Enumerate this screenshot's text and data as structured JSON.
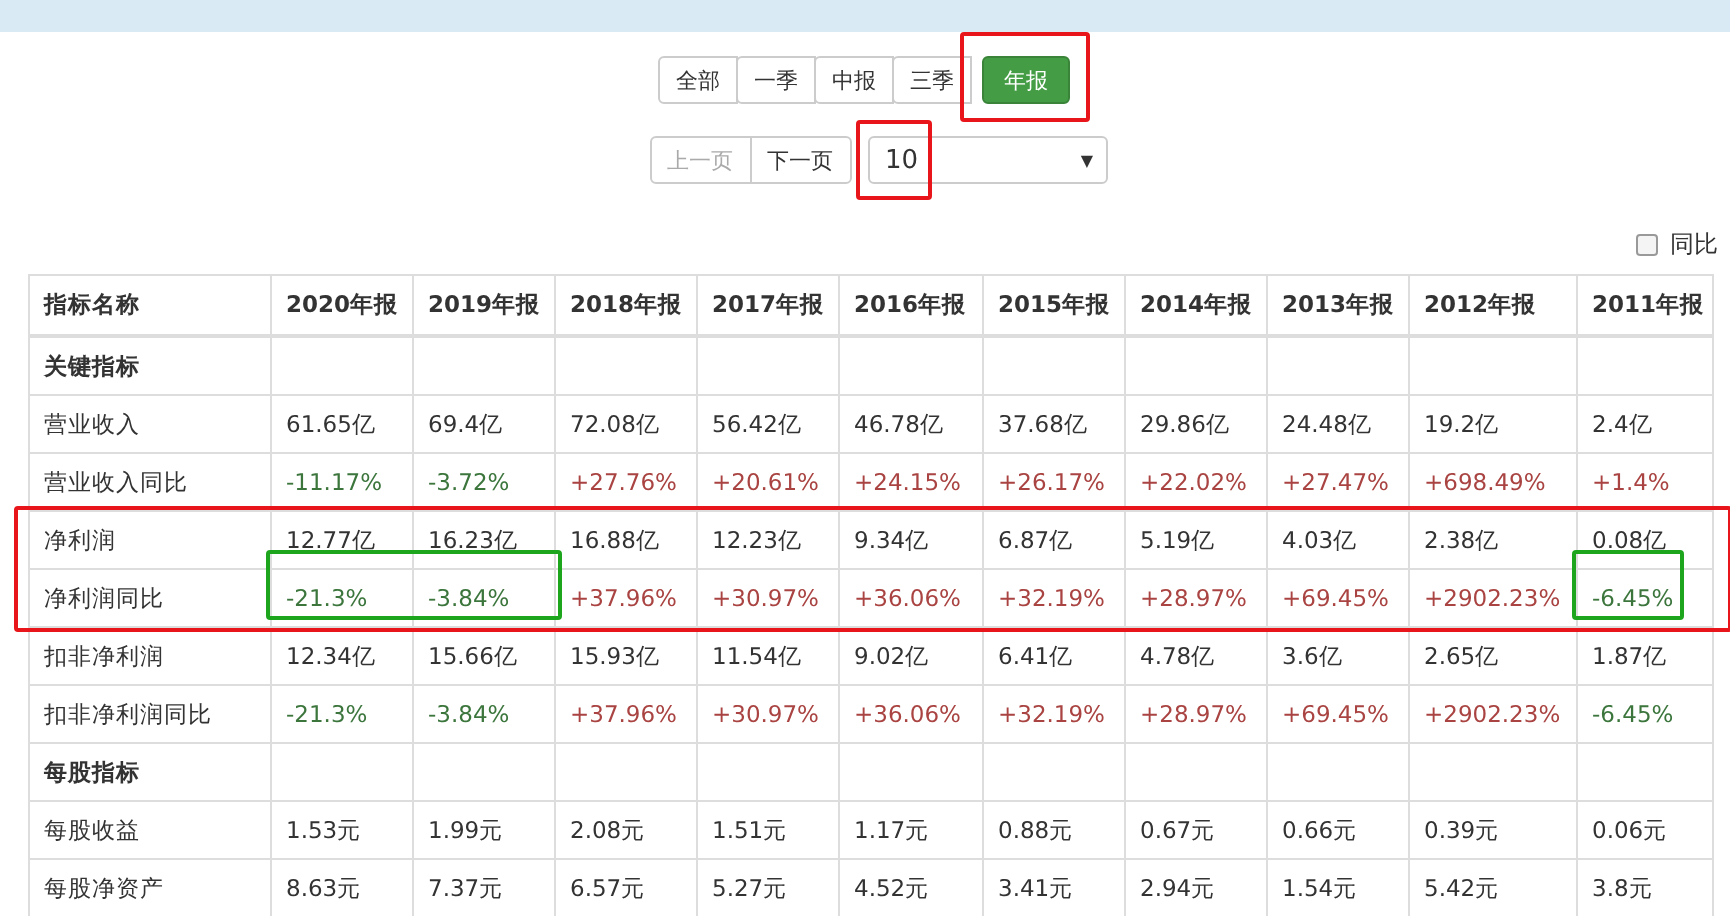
{
  "period_tabs": [
    {
      "label": "全部",
      "selected": false,
      "boxed": false
    },
    {
      "label": "一季",
      "selected": false,
      "boxed": false
    },
    {
      "label": "中报",
      "selected": false,
      "boxed": false
    },
    {
      "label": "三季",
      "selected": false,
      "boxed": false
    },
    {
      "label": "年报",
      "selected": true,
      "boxed": true
    }
  ],
  "pager": {
    "prev": {
      "label": "上一页",
      "disabled": true
    },
    "next": {
      "label": "下一页",
      "disabled": false
    },
    "page_size": {
      "value": "10",
      "caret": "▼",
      "boxed": true
    }
  },
  "yoy_toggle": {
    "label": "同比",
    "checked": false
  },
  "table": {
    "columns": [
      "指标名称",
      "2020年报",
      "2019年报",
      "2018年报",
      "2017年报",
      "2016年报",
      "2015年报",
      "2014年报",
      "2013年报",
      "2012年报",
      "2011年报"
    ],
    "rows": [
      {
        "kind": "section",
        "cells": [
          {
            "text": "关键指标"
          }
        ]
      },
      {
        "kind": "value",
        "cells": [
          {
            "text": "营业收入"
          },
          {
            "text": "61.65亿"
          },
          {
            "text": "69.4亿"
          },
          {
            "text": "72.08亿"
          },
          {
            "text": "56.42亿"
          },
          {
            "text": "46.78亿"
          },
          {
            "text": "37.68亿"
          },
          {
            "text": "29.86亿"
          },
          {
            "text": "24.48亿"
          },
          {
            "text": "19.2亿"
          },
          {
            "text": "2.4亿"
          }
        ]
      },
      {
        "kind": "value",
        "cells": [
          {
            "text": "营业收入同比"
          },
          {
            "text": "-11.17%",
            "color": "#3c763d"
          },
          {
            "text": "-3.72%",
            "color": "#3c763d"
          },
          {
            "text": "+27.76%",
            "color": "#a94442"
          },
          {
            "text": "+20.61%",
            "color": "#a94442"
          },
          {
            "text": "+24.15%",
            "color": "#a94442"
          },
          {
            "text": "+26.17%",
            "color": "#a94442"
          },
          {
            "text": "+22.02%",
            "color": "#a94442"
          },
          {
            "text": "+27.47%",
            "color": "#a94442"
          },
          {
            "text": "+698.49%",
            "color": "#a94442"
          },
          {
            "text": "+1.4%",
            "color": "#a94442"
          }
        ]
      },
      {
        "kind": "value",
        "boxed": true,
        "cells": [
          {
            "text": "净利润"
          },
          {
            "text": "12.77亿"
          },
          {
            "text": "16.23亿"
          },
          {
            "text": "16.88亿"
          },
          {
            "text": "12.23亿"
          },
          {
            "text": "9.34亿"
          },
          {
            "text": "6.87亿"
          },
          {
            "text": "5.19亿"
          },
          {
            "text": "4.03亿"
          },
          {
            "text": "2.38亿"
          },
          {
            "text": "0.08亿"
          }
        ]
      },
      {
        "kind": "value",
        "boxed": true,
        "cells": [
          {
            "text": "净利润同比"
          },
          {
            "text": "-21.3%",
            "color": "#3c763d",
            "boxed": true
          },
          {
            "text": "-3.84%",
            "color": "#3c763d",
            "boxed": true
          },
          {
            "text": "+37.96%",
            "color": "#a94442"
          },
          {
            "text": "+30.97%",
            "color": "#a94442"
          },
          {
            "text": "+36.06%",
            "color": "#a94442"
          },
          {
            "text": "+32.19%",
            "color": "#a94442"
          },
          {
            "text": "+28.97%",
            "color": "#a94442"
          },
          {
            "text": "+69.45%",
            "color": "#a94442"
          },
          {
            "text": "+2902.23%",
            "color": "#a94442"
          },
          {
            "text": "-6.45%",
            "color": "#3c763d",
            "boxed": true
          }
        ]
      },
      {
        "kind": "value",
        "cells": [
          {
            "text": "扣非净利润"
          },
          {
            "text": "12.34亿"
          },
          {
            "text": "15.66亿"
          },
          {
            "text": "15.93亿"
          },
          {
            "text": "11.54亿"
          },
          {
            "text": "9.02亿"
          },
          {
            "text": "6.41亿"
          },
          {
            "text": "4.78亿"
          },
          {
            "text": "3.6亿"
          },
          {
            "text": "2.65亿"
          },
          {
            "text": "1.87亿"
          }
        ]
      },
      {
        "kind": "value",
        "cells": [
          {
            "text": "扣非净利润同比"
          },
          {
            "text": "-21.3%",
            "color": "#3c763d"
          },
          {
            "text": "-3.84%",
            "color": "#3c763d"
          },
          {
            "text": "+37.96%",
            "color": "#a94442"
          },
          {
            "text": "+30.97%",
            "color": "#a94442"
          },
          {
            "text": "+36.06%",
            "color": "#a94442"
          },
          {
            "text": "+32.19%",
            "color": "#a94442"
          },
          {
            "text": "+28.97%",
            "color": "#a94442"
          },
          {
            "text": "+69.45%",
            "color": "#a94442"
          },
          {
            "text": "+2902.23%",
            "color": "#a94442"
          },
          {
            "text": "-6.45%",
            "color": "#3c763d"
          }
        ]
      },
      {
        "kind": "section",
        "cells": [
          {
            "text": "每股指标"
          }
        ]
      },
      {
        "kind": "value",
        "cells": [
          {
            "text": "每股收益"
          },
          {
            "text": "1.53元"
          },
          {
            "text": "1.99元"
          },
          {
            "text": "2.08元"
          },
          {
            "text": "1.51元"
          },
          {
            "text": "1.17元"
          },
          {
            "text": "0.88元"
          },
          {
            "text": "0.67元"
          },
          {
            "text": "0.66元"
          },
          {
            "text": "0.39元"
          },
          {
            "text": "0.06元"
          }
        ]
      },
      {
        "kind": "value",
        "cells": [
          {
            "text": "每股净资产"
          },
          {
            "text": "8.63元"
          },
          {
            "text": "7.37元"
          },
          {
            "text": "6.57元"
          },
          {
            "text": "5.27元"
          },
          {
            "text": "4.52元"
          },
          {
            "text": "3.41元"
          },
          {
            "text": "2.94元"
          },
          {
            "text": "1.54元"
          },
          {
            "text": "5.42元"
          },
          {
            "text": "3.8元"
          }
        ]
      }
    ]
  }
}
